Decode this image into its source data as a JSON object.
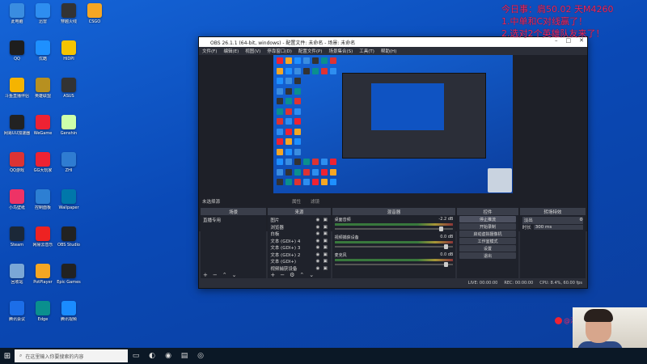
{
  "desktop_icons": [
    {
      "label": "此电脑",
      "icon": "computer-icon",
      "color": "#3a8de0"
    },
    {
      "label": "QQ",
      "icon": "qq-icon",
      "color": "#1e1e1e"
    },
    {
      "label": "斗鱼直播伴侣",
      "icon": "douyu-icon",
      "color": "#f5b400"
    },
    {
      "label": "网易UU加速器",
      "icon": "uu-icon",
      "color": "#222"
    },
    {
      "label": "QQ游戏",
      "icon": "qqgame-icon",
      "color": "#d33"
    },
    {
      "label": "小鸟壁纸",
      "icon": "bird-icon",
      "color": "#e36"
    },
    {
      "label": "Steam",
      "icon": "steam-icon",
      "color": "#1b2838"
    },
    {
      "label": "回收站",
      "icon": "recycle-icon",
      "color": "#7aa7d6"
    },
    {
      "label": "腾讯会议",
      "icon": "meeting-icon",
      "color": "#1c6ee8"
    },
    {
      "label": "迅雷",
      "icon": "xunlei-icon",
      "color": "#2e8ef0"
    },
    {
      "label": "优酷",
      "icon": "youku-icon",
      "color": "#1e90ff"
    },
    {
      "label": "英雄联盟",
      "icon": "lol-icon",
      "color": "#b79020"
    },
    {
      "label": "WeGame",
      "icon": "wegame-icon",
      "color": "#e23"
    },
    {
      "label": "GG大玩家",
      "icon": "gg-icon",
      "color": "#e23"
    },
    {
      "label": "控制面板",
      "icon": "control-icon",
      "color": "#2d7fd3"
    },
    {
      "label": "网易云音乐",
      "icon": "music-icon",
      "color": "#e22"
    },
    {
      "label": "PotPlayer",
      "icon": "pot-icon",
      "color": "#f5a623"
    },
    {
      "label": "Edge",
      "icon": "edge-icon",
      "color": "#0a8f8e"
    },
    {
      "label": "穿越火线",
      "icon": "cf-icon",
      "color": "#333"
    },
    {
      "label": "HiDPI",
      "icon": "hidpi-icon",
      "color": "#f5c400"
    },
    {
      "label": "ASUS",
      "icon": "asus-icon",
      "color": "#333"
    },
    {
      "label": "Genshin",
      "icon": "genshin-icon",
      "color": "#cfa"
    },
    {
      "label": "ZHI",
      "icon": "zhi-icon",
      "color": "#2f7cd1"
    },
    {
      "label": "Wallpaper",
      "icon": "wallpaper-icon",
      "color": "#07a"
    },
    {
      "label": "OBS Studio",
      "icon": "obs-icon",
      "color": "#222"
    },
    {
      "label": "Epic Games",
      "icon": "epic-icon",
      "color": "#222"
    },
    {
      "label": "腾讯视频",
      "icon": "txvideo-icon",
      "color": "#1a8cff"
    },
    {
      "label": "CSGO",
      "icon": "csgo-icon",
      "color": "#f5a623"
    }
  ],
  "obs": {
    "title": "OBS 26.1.1 (64-bit, windows) - 配置文件: 未命名 - 场景: 未命名",
    "menu": [
      "文件(F)",
      "编辑(E)",
      "视图(V)",
      "停靠窗口(D)",
      "配置文件(P)",
      "场景集合(S)",
      "工具(T)",
      "帮助(H)"
    ],
    "scene_label": "未选择源",
    "tools": [
      "属性",
      "滤镜"
    ],
    "docks": {
      "scenes_title": "场景",
      "scenes": [
        "直播专用"
      ],
      "sources_title": "来源",
      "sources": [
        "图片",
        "浏览器",
        "白板",
        "文本 (GDI+) 4",
        "文本 (GDI+) 3",
        "文本 (GDI+) 2",
        "文本 (GDI+)",
        "视频捕获设备"
      ],
      "mixer_title": "混音器",
      "mixer": [
        {
          "name": "桌面音频",
          "db": "-2.2 dB"
        },
        {
          "name": "视频捕获设备",
          "db": "0.0 dB"
        },
        {
          "name": "麦克风",
          "db": "0.0 dB"
        }
      ],
      "transitions_title": "转场特效",
      "transition": "淡出",
      "duration_label": "时长",
      "duration": "300 ms",
      "controls_title": "控件",
      "controls": [
        "停止推流",
        "开始录制",
        "启动虚拟摄像机",
        "工作室模式",
        "设置",
        "退出"
      ]
    },
    "status": {
      "live": "LIVE: 00:00:00",
      "rec": "REC: 00:00:00",
      "cpu": "CPU: 8.4%, 60.00 fps"
    }
  },
  "overlay": [
    "今日事：肩50.02 天M4260",
    "1.中单和C对线赢了！",
    "2.选对2个英雄队友来了！"
  ],
  "weibo_tag": "@汤厂",
  "taskbar": {
    "search_placeholder": "在这里输入你要搜索的内容"
  },
  "colors": {
    "accent": "#e52a66",
    "desktop": "#1565d8"
  }
}
